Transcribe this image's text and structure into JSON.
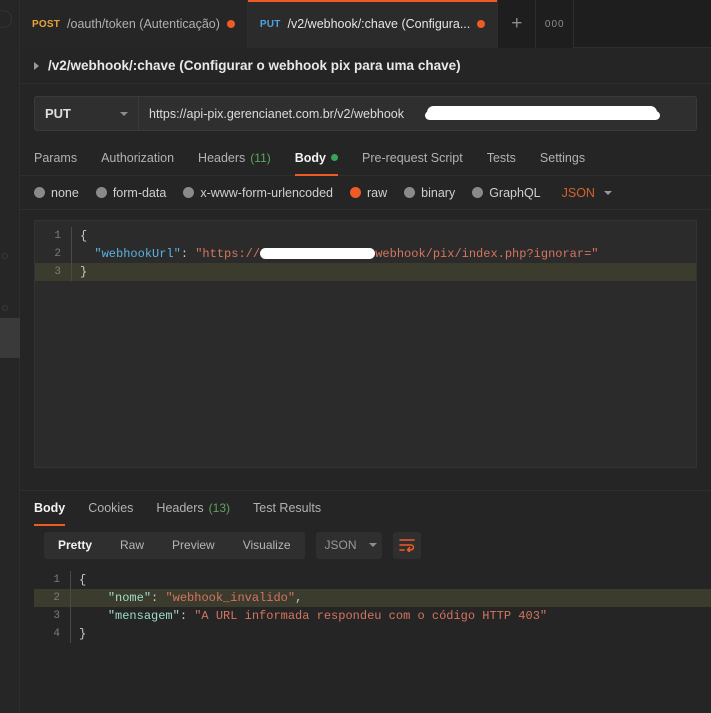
{
  "app": {
    "theme_bg": "#252525",
    "accent": "#ef5b25"
  },
  "tabs": [
    {
      "verb": "POST",
      "name": "/oauth/token (Autenticação)",
      "active": false,
      "unsaved": true
    },
    {
      "verb": "PUT",
      "name": "/v2/webhook/:chave (Configura...",
      "active": true,
      "unsaved": true
    }
  ],
  "tab_actions": {
    "new_tab": "+",
    "more": "000"
  },
  "request": {
    "title": "/v2/webhook/:chave (Configurar o webhook pix para uma chave)",
    "method": "PUT",
    "url": "https://api-pix.gerencianet.com.br/v2/webhook",
    "url_redacted_suffix": "",
    "tabs": [
      {
        "label": "Params",
        "active": false
      },
      {
        "label": "Authorization",
        "active": false
      },
      {
        "label": "Headers",
        "count": "(11)",
        "active": false
      },
      {
        "label": "Body",
        "active": true,
        "dot": true
      },
      {
        "label": "Pre-request Script",
        "active": false
      },
      {
        "label": "Tests",
        "active": false
      },
      {
        "label": "Settings",
        "active": false
      }
    ],
    "body_types": [
      {
        "label": "none",
        "selected": false
      },
      {
        "label": "form-data",
        "selected": false
      },
      {
        "label": "x-www-form-urlencoded",
        "selected": false
      },
      {
        "label": "raw",
        "selected": true
      },
      {
        "label": "binary",
        "selected": false
      },
      {
        "label": "GraphQL",
        "selected": false
      }
    ],
    "language": "JSON",
    "body_lines": [
      {
        "n": "1",
        "highlight": false,
        "tokens": [
          {
            "c": "tk-punc",
            "t": "{"
          }
        ]
      },
      {
        "n": "2",
        "highlight": false,
        "tokens": [
          {
            "c": "tk-punc",
            "t": "  "
          },
          {
            "c": "tk-key",
            "t": "\"webhookUrl\""
          },
          {
            "c": "tk-col",
            "t": ": "
          },
          {
            "c": "tk-str",
            "t": "\"https://"
          },
          {
            "c": "redact",
            "t": "                "
          },
          {
            "c": "tk-str",
            "t": "webhook/pix/index.php?ignorar=\""
          }
        ]
      },
      {
        "n": "3",
        "highlight": true,
        "tokens": [
          {
            "c": "tk-punc",
            "t": "}"
          }
        ]
      }
    ]
  },
  "response": {
    "tabs": [
      {
        "label": "Body",
        "active": true
      },
      {
        "label": "Cookies",
        "active": false
      },
      {
        "label": "Headers",
        "count": "(13)",
        "active": false
      },
      {
        "label": "Test Results",
        "active": false
      }
    ],
    "formats": [
      {
        "label": "Pretty",
        "active": true
      },
      {
        "label": "Raw",
        "active": false
      },
      {
        "label": "Preview",
        "active": false
      },
      {
        "label": "Visualize",
        "active": false
      }
    ],
    "language": "JSON",
    "wrap_icon": "wrap-text-icon",
    "body_lines": [
      {
        "n": "1",
        "highlight": false,
        "tokens": [
          {
            "c": "tk-punc",
            "t": "{"
          }
        ]
      },
      {
        "n": "2",
        "highlight": true,
        "tokens": [
          {
            "c": "tk-punc",
            "t": "    "
          },
          {
            "c": "tk-key2",
            "t": "\"nome\""
          },
          {
            "c": "tk-col",
            "t": ": "
          },
          {
            "c": "tk-str",
            "t": "\"webhook_invalido\""
          },
          {
            "c": "tk-punc",
            "t": ","
          }
        ]
      },
      {
        "n": "3",
        "highlight": false,
        "tokens": [
          {
            "c": "tk-punc",
            "t": "    "
          },
          {
            "c": "tk-key2",
            "t": "\"mensagem\""
          },
          {
            "c": "tk-col",
            "t": ": "
          },
          {
            "c": "tk-str",
            "t": "\"A URL informada respondeu com o código HTTP 403\""
          }
        ]
      },
      {
        "n": "4",
        "highlight": false,
        "tokens": [
          {
            "c": "tk-punc",
            "t": "}"
          }
        ]
      }
    ]
  }
}
